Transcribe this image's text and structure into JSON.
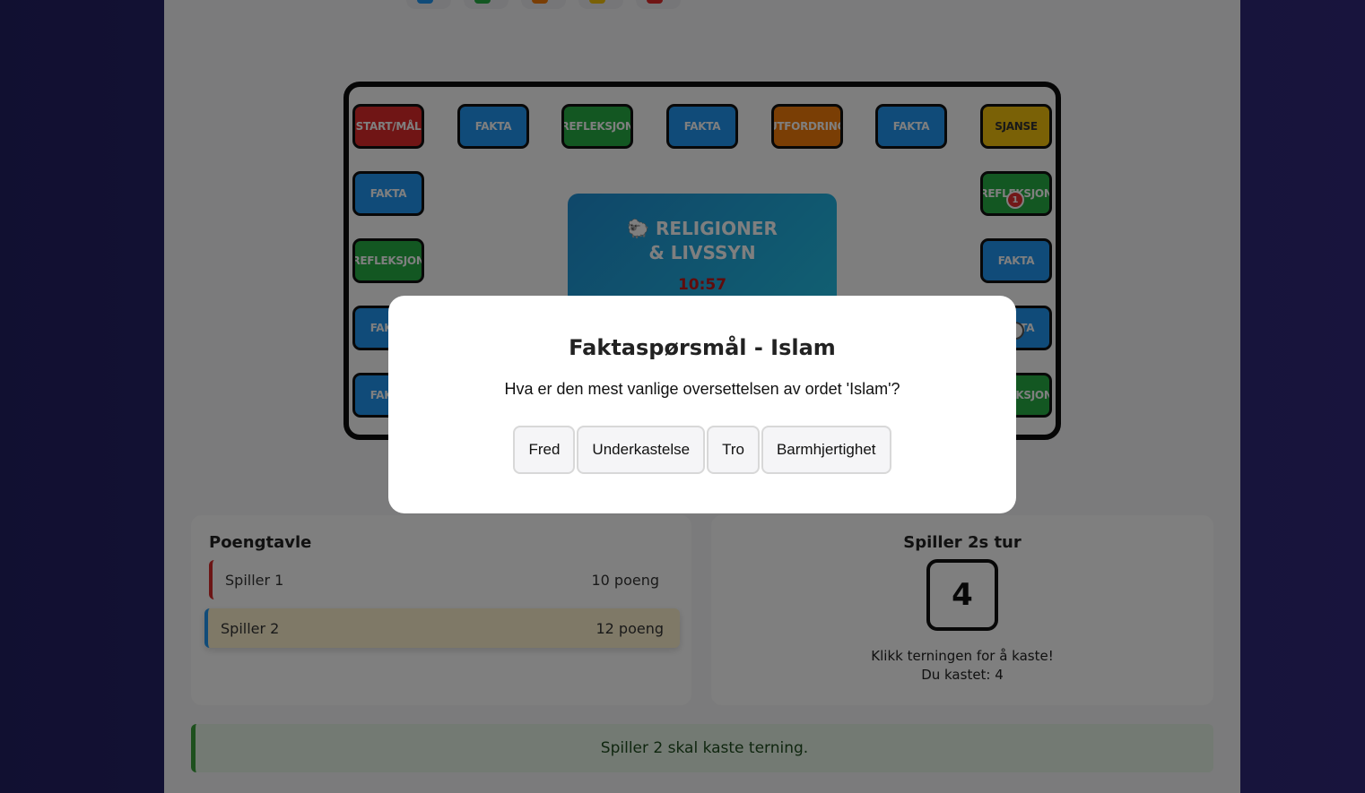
{
  "legend": [
    {
      "color": "#2196f3"
    },
    {
      "color": "#27ae44"
    },
    {
      "color": "#f57d0a"
    },
    {
      "color": "#f4c20d"
    },
    {
      "color": "#e02a2a"
    }
  ],
  "board": {
    "tiles": [
      {
        "label": "START/MÅL",
        "kind": "red"
      },
      {
        "label": "FAKTA",
        "kind": "blue"
      },
      {
        "label": "REFLEKSJON",
        "kind": "green"
      },
      {
        "label": "FAKTA",
        "kind": "blue"
      },
      {
        "label": "UTFORDRING",
        "kind": "orange"
      },
      {
        "label": "FAKTA",
        "kind": "blue"
      },
      {
        "label": "SJANSE",
        "kind": "yellow"
      },
      {
        "label": "FAKTA",
        "kind": "blue"
      },
      {
        "label": "REFLEKSJON",
        "kind": "green"
      },
      {
        "label": "REFLEKSJON",
        "kind": "green"
      },
      {
        "label": "FAKTA",
        "kind": "blue"
      },
      {
        "label": "FAKTA",
        "kind": "blue"
      },
      {
        "label": "FAKTA",
        "kind": "blue"
      },
      {
        "label": "FAKTA",
        "kind": "blue"
      },
      {
        "label": "REFLEKSJON",
        "kind": "green"
      }
    ],
    "center_title_line1": "🐑 RELIGIONER",
    "center_title_line2": "& LIVSSYN",
    "timer": "10:57",
    "player_token_label": "1"
  },
  "scoreboard": {
    "title": "Poengtavle",
    "rows": [
      {
        "player": "Spiller 1",
        "score": "10 poeng"
      },
      {
        "player": "Spiller 2",
        "score": "12 poeng"
      }
    ]
  },
  "turn": {
    "title": "Spiller 2s tur",
    "dice_value": "4",
    "hint": "Klikk terningen for å kaste!",
    "last_roll": "Du kastet: 4"
  },
  "status": {
    "message": "Spiller 2 skal kaste terning."
  },
  "modal": {
    "title": "Faktaspørsmål - Islam",
    "question": "Hva er den mest vanlige oversettelsen av ordet 'Islam'?",
    "answers": [
      "Fred",
      "Underkastelse",
      "Tro",
      "Barmhjertighet"
    ]
  }
}
